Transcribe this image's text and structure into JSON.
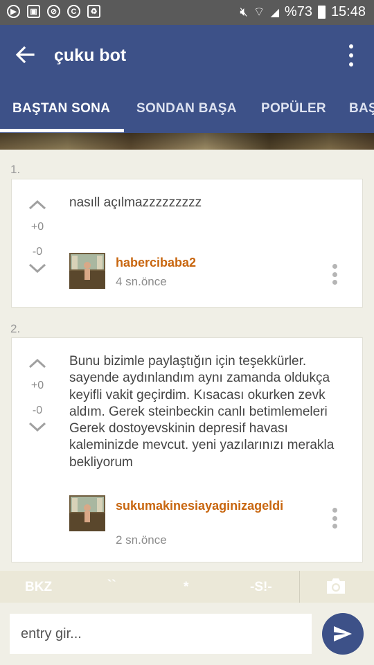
{
  "status_bar": {
    "battery": "%73",
    "time": "15:48"
  },
  "app_bar": {
    "title": "çuku bot",
    "icons": {
      "back": "arrow-left-icon",
      "menu": "more-vert-icon"
    }
  },
  "tabs": [
    {
      "label": "BAŞTAN SONA",
      "active": true
    },
    {
      "label": "SONDAN BAŞA",
      "active": false
    },
    {
      "label": "POPÜLER",
      "active": false
    },
    {
      "label": "BAŞ",
      "active": false
    }
  ],
  "entries": [
    {
      "number": "1.",
      "text": "nasıll açılmazzzzzzzzz",
      "upvotes": "+0",
      "downvotes": "-0",
      "author": "habercibaba2",
      "time_ago": "4 sn.önce"
    },
    {
      "number": "2.",
      "text": "Bunu bizimle paylaştığın için teşekkürler. sayende aydınlandım aynı zamanda oldukça keyifli vakit geçirdim. Kısacası okurken zevk aldım. Gerek steinbeckin canlı betimlemeleri Gerek dostoyevskinin depresif havası kaleminizde mevcut. yeni yazılarınızı merakla bekliyorum",
      "upvotes": "+0",
      "downvotes": "-0",
      "author": "sukumakinesiayaginizageldi",
      "time_ago": "2 sn.önce"
    }
  ],
  "helper_bar": {
    "bkz": "BKZ",
    "backticks": "``",
    "asterisk": "*",
    "spoiler": "-S!-"
  },
  "composer": {
    "placeholder": "entry gir..."
  },
  "colors": {
    "primary": "#3d5188",
    "author": "#c8660f",
    "background": "#f0efe6"
  }
}
